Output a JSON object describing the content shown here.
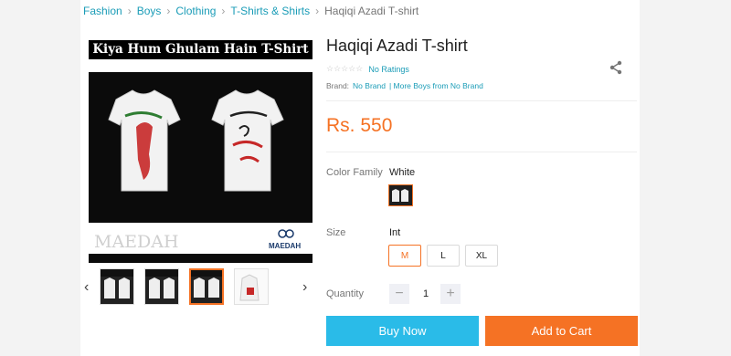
{
  "breadcrumb": [
    "Fashion",
    "Boys",
    "Clothing",
    "T-Shirts & Shirts"
  ],
  "breadcrumb_current": "Haqiqi Azadi T-shirt",
  "hero": {
    "title": "Kiya Hum Ghulam Hain T-Shirt",
    "watermark": "MAEDAH"
  },
  "product": {
    "title": "Haqiqi Azadi T-shirt",
    "stars": "☆☆☆☆☆",
    "ratings": "No Ratings",
    "brand_label": "Brand:",
    "brand": "No Brand",
    "brand_more": "| More Boys from No Brand",
    "price": "Rs. 550"
  },
  "options": {
    "color_label": "Color Family",
    "color_value": "White",
    "size_label": "Size",
    "size_value": "Int",
    "sizes": [
      "M",
      "L",
      "XL"
    ],
    "selected_size": "M",
    "quantity_label": "Quantity",
    "quantity": "1",
    "minus": "−",
    "plus": "+"
  },
  "actions": {
    "buy": "Buy Now",
    "cart": "Add to Cart"
  },
  "colors": {
    "accent": "#f57224",
    "link": "#1a9cb7",
    "buy": "#2abbe8"
  },
  "icons": {
    "share": "share-icon",
    "prev": "chevron-left-icon",
    "next": "chevron-right-icon"
  }
}
